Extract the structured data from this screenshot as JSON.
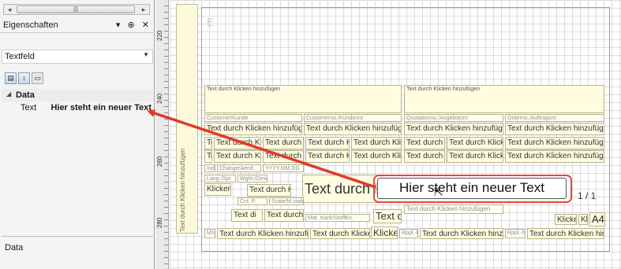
{
  "panel": {
    "scroll_grip": "|||",
    "title": "Eigenschaften",
    "title_buttons": "▾ ⊕ ✕",
    "object_type": "Textfeld",
    "category_label": "Data",
    "property_name": "Text",
    "property_value": "Hier steht ein neuer Text",
    "description_title": "Data"
  },
  "ruler": {
    "labels": [
      "220",
      "240",
      "260",
      "280"
    ]
  },
  "canvas": {
    "frame_label": "E",
    "vertical_label": "Text durch Klicken hinzufügen",
    "placeholder": "Text durch Klicken hinzufügen",
    "labels": {
      "customer": "Customer/Kunde",
      "customerno": "Customerno./Kundennr.",
      "quotation": "Quotationno./Angebotsnr.",
      "order": "Orderno./Auftragsnr.",
      "ind": "Ind.",
      "change": "Change/Aend.",
      "date": "YYYY.MM.DD",
      "lang": "Lang./Spr.",
      "weight": "Wght./Gew.",
      "cnt": "Cnt. P.",
      "scale": "Scale/M.stab",
      "mat": "Mat. mark/StoffKn.",
      "mnr": "MNR",
      "rppl": "Rppl.-for"
    },
    "short_text_1": "Text d",
    "short_text_2": "Text di",
    "klicken": "Klicken",
    "klicken2": "Klicken",
    "klicken3": "Klicken",
    "page_of": "1 / 1",
    "format": "A4"
  },
  "callout": {
    "text": "Hier steht ein neuer Text"
  }
}
